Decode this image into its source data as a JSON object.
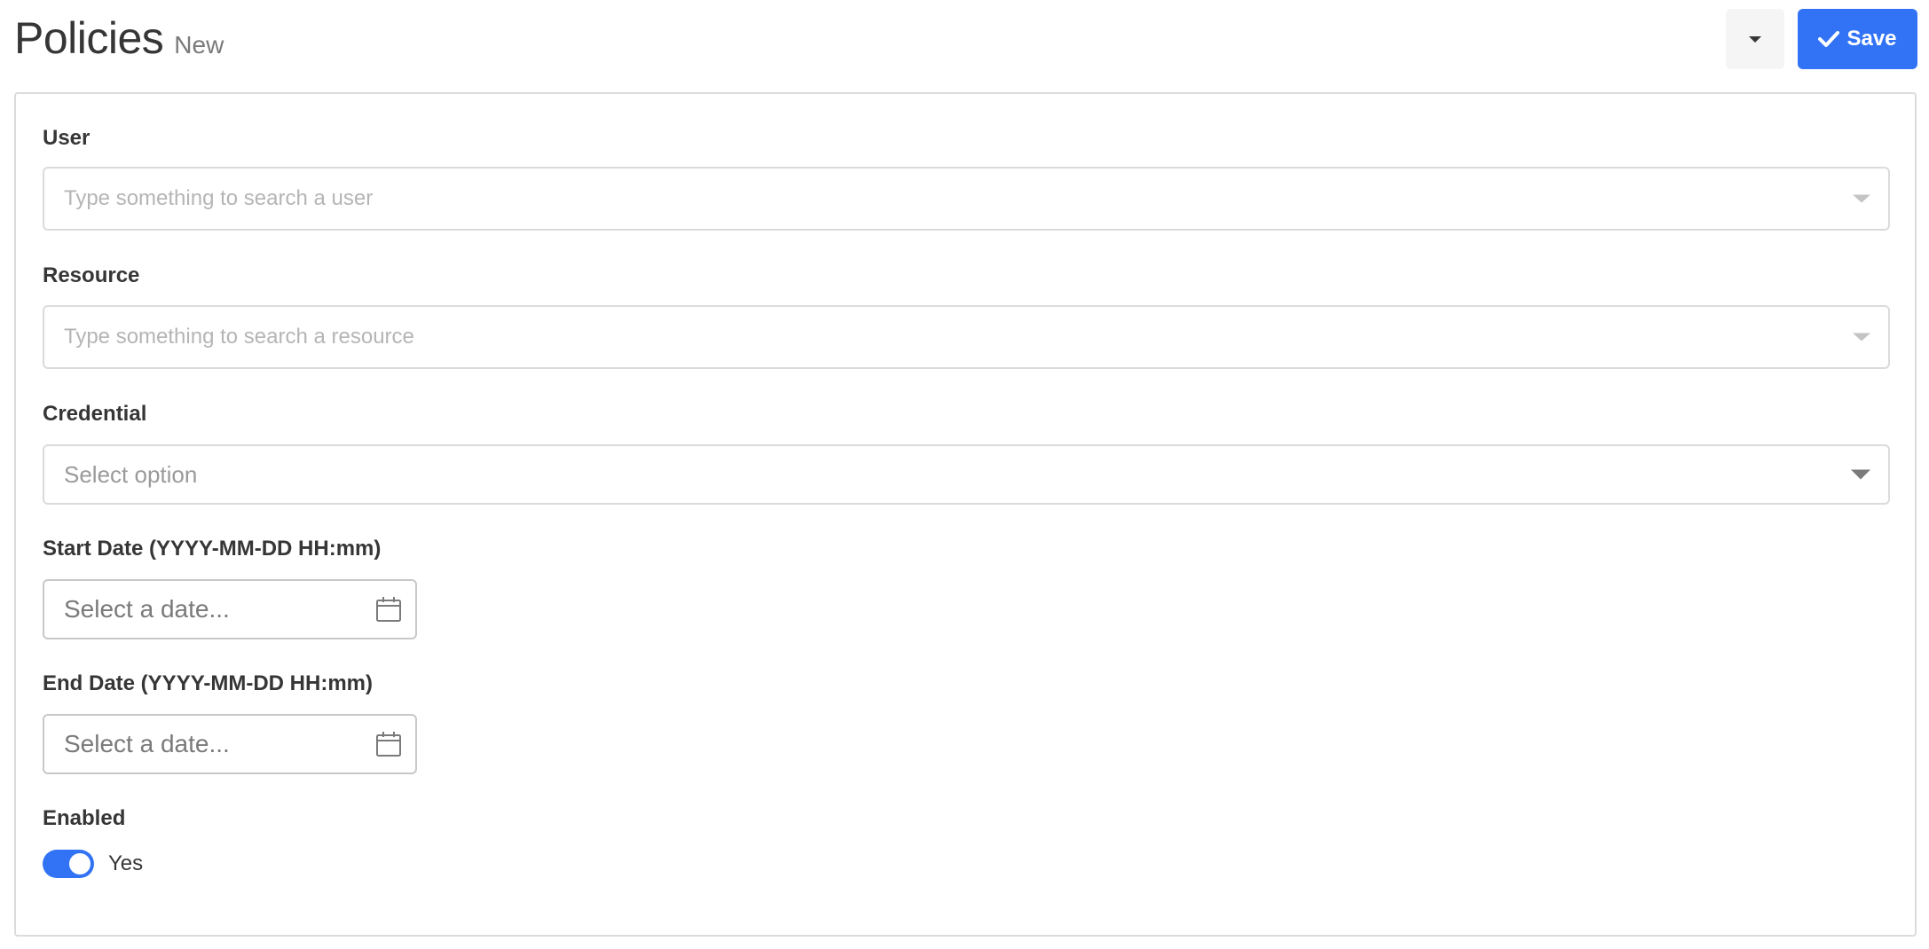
{
  "header": {
    "title": "Policies",
    "subtitle": "New",
    "save_label": "Save"
  },
  "form": {
    "user": {
      "label": "User",
      "placeholder": "Type something to search a user"
    },
    "resource": {
      "label": "Resource",
      "placeholder": "Type something to search a resource"
    },
    "credential": {
      "label": "Credential",
      "placeholder": "Select option"
    },
    "start_date": {
      "label": "Start Date (YYYY-MM-DD HH:mm)",
      "placeholder": "Select a date..."
    },
    "end_date": {
      "label": "End Date (YYYY-MM-DD HH:mm)",
      "placeholder": "Select a date..."
    },
    "enabled": {
      "label": "Enabled",
      "value": "Yes",
      "on": true
    }
  },
  "colors": {
    "accent": "#3273f6",
    "border": "#dbdbdb",
    "text": "#363636",
    "placeholder": "#b5b5b5"
  },
  "icons": {
    "dropdown": "caret-down-icon",
    "save": "check-icon",
    "calendar": "calendar-icon",
    "select_arrow": "chevron-down-icon"
  }
}
